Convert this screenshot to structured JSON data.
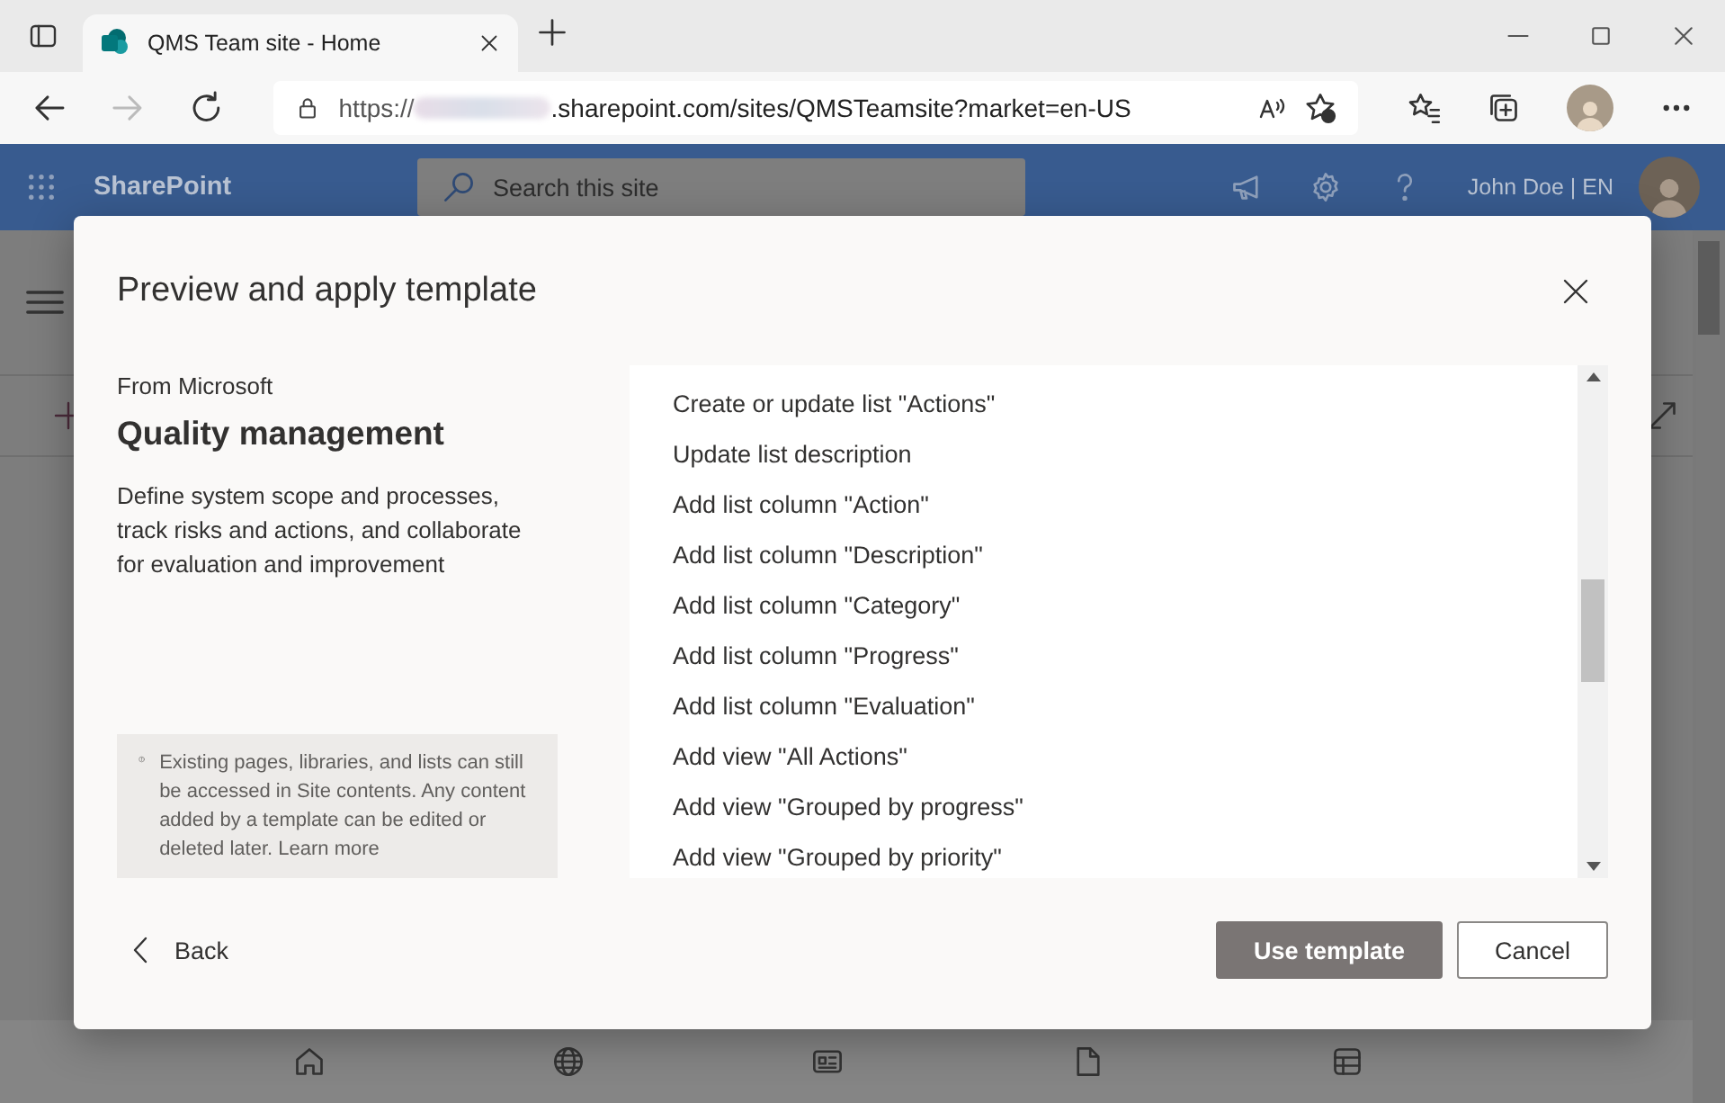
{
  "browser": {
    "tab": {
      "title": "QMS Team site - Home"
    },
    "forward_disabled": true,
    "address": {
      "scheme": "https://",
      "rest": ".sharepoint.com/sites/QMSTeamsite?market=en-US"
    }
  },
  "suite_bar": {
    "app_name": "SharePoint",
    "search": {
      "placeholder": "Search this site"
    },
    "user": "John Doe | EN"
  },
  "dialog": {
    "title": "Preview and apply template",
    "source": "From Microsoft",
    "template_name": "Quality management",
    "description": "Define system scope and processes, track risks and actions, and collaborate for evaluation and improvement",
    "notice": {
      "text": "Existing pages, libraries, and lists can still be accessed in Site contents. Any content added by a template can be edited or deleted later.",
      "link": "Learn more"
    },
    "actions": [
      "Create or update list \"Actions\"",
      "Update list description",
      "Add list column \"Action\"",
      "Add list column \"Description\"",
      "Add list column \"Category\"",
      "Add list column \"Progress\"",
      "Add list column \"Evaluation\"",
      "Add view \"All Actions\"",
      "Add view \"Grouped by progress\"",
      "Add view \"Grouped by priority\""
    ],
    "back": "Back",
    "buttons": [
      {
        "label": "Use template",
        "kind": "primary"
      },
      {
        "label": "Cancel",
        "kind": "secondary"
      }
    ]
  }
}
